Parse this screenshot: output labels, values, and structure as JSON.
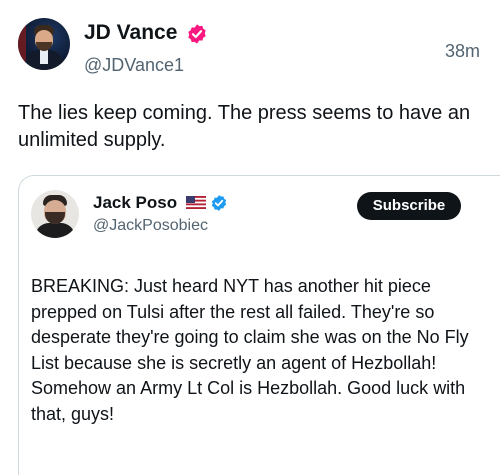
{
  "tweet": {
    "author_name": "JD Vance",
    "author_handle": "@JDVance1",
    "timestamp": "38m",
    "text": "The lies keep coming. The press seems to have an unlimited supply.",
    "verified_badge_color": "#f91880"
  },
  "quoted": {
    "author_name": "Jack Poso",
    "author_handle": "@JackPosobiec",
    "subscribe_label": "Subscribe",
    "text": "BREAKING: Just heard NYT has another hit piece prepped on Tulsi after the rest all failed. They're so desperate they're going to claim she was on the No Fly List because she is secretly an agent of Hezbollah! Somehow an Army Lt Col is Hezbollah. Good luck with that, guys!",
    "verified_badge_color": "#1d9bf0",
    "flag_icon": "us-flag-icon"
  }
}
